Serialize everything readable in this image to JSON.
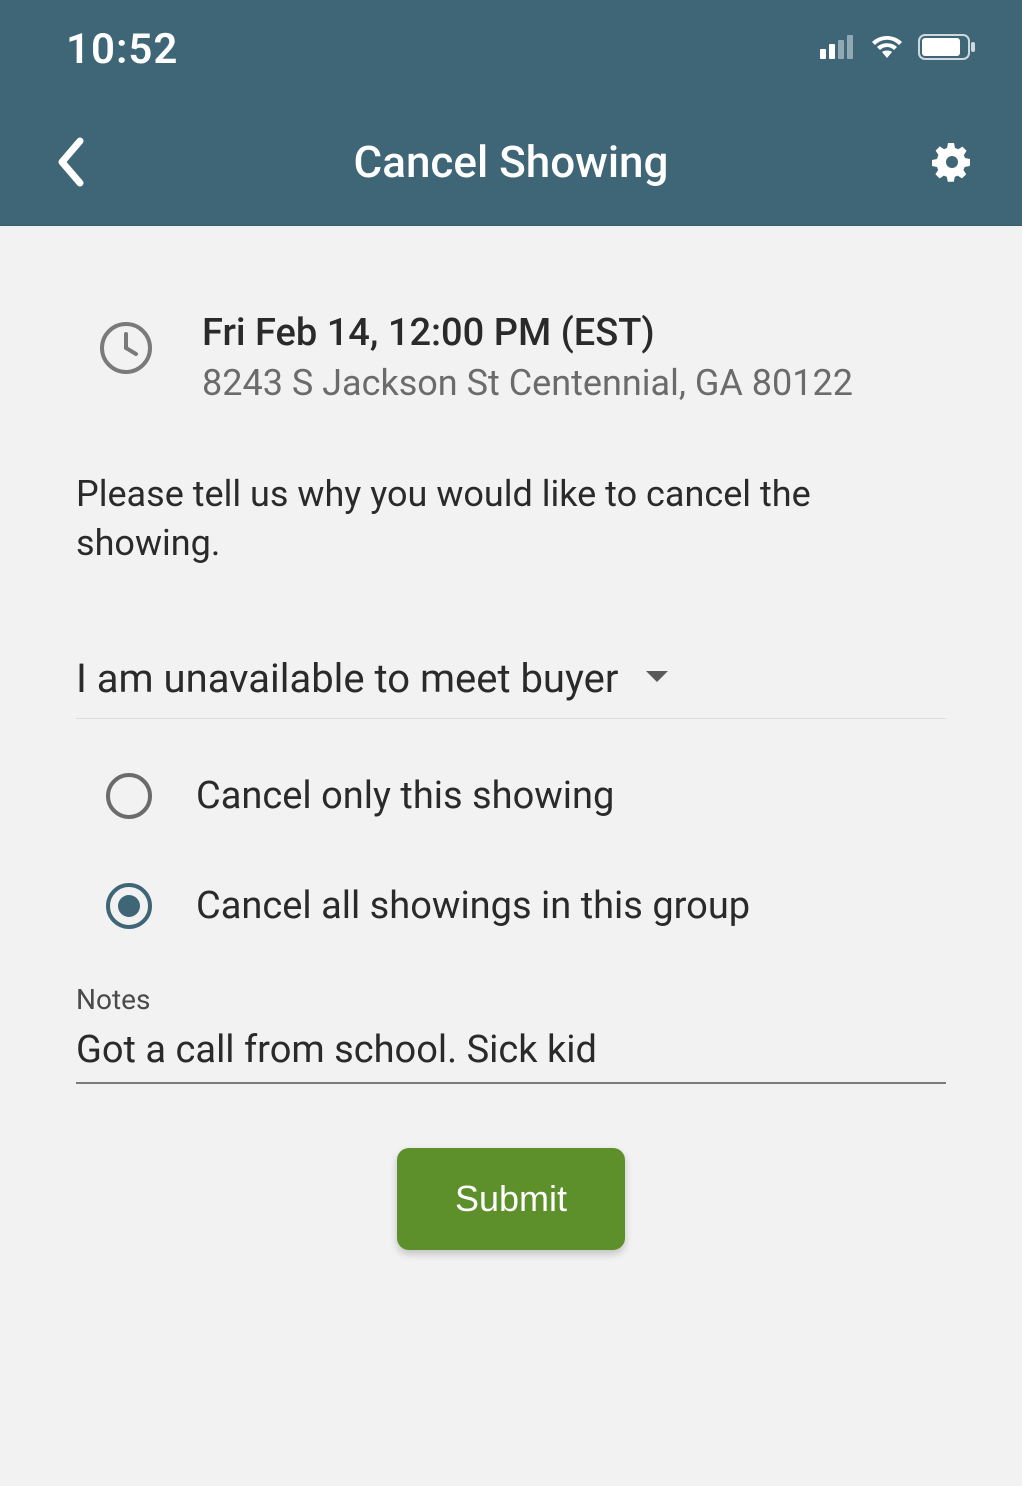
{
  "statusbar": {
    "time": "10:52"
  },
  "navbar": {
    "title": "Cancel Showing"
  },
  "showing": {
    "datetime": "Fri Feb 14, 12:00 PM (EST)",
    "address": "8243 S Jackson St  Centennial, GA 80122"
  },
  "prompt": "Please tell us why you would like to cancel the showing.",
  "reason": {
    "selected_label": "I am unavailable to meet buyer"
  },
  "scope_options": [
    {
      "label": "Cancel only this showing",
      "selected": false
    },
    {
      "label": "Cancel all showings in this group",
      "selected": true
    }
  ],
  "notes": {
    "label": "Notes",
    "value": "Got a call from school. Sick kid"
  },
  "submit_label": "Submit"
}
